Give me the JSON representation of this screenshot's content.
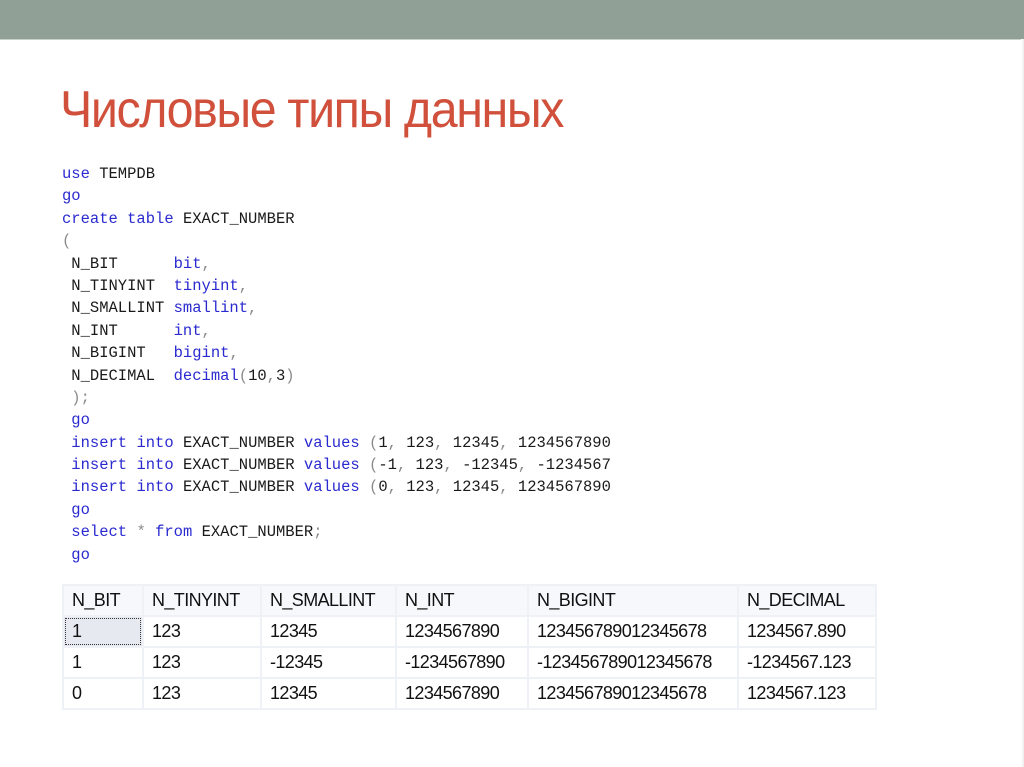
{
  "slide": {
    "title": "Числовые типы данных",
    "colors": {
      "top_bar": "#91a096",
      "title": "#d0503c",
      "keyword": "#2a2ad0"
    }
  },
  "code": {
    "lines": [
      [
        {
          "t": "kw",
          "v": "use"
        },
        {
          "t": "id",
          "v": " TEMPDB"
        }
      ],
      [
        {
          "t": "kw",
          "v": "go"
        }
      ],
      [
        {
          "t": "kw",
          "v": "create"
        },
        {
          "t": "id",
          "v": " "
        },
        {
          "t": "kw",
          "v": "table"
        },
        {
          "t": "id",
          "v": " EXACT_NUMBER"
        }
      ],
      [
        {
          "t": "pn",
          "v": "("
        }
      ],
      [
        {
          "t": "id",
          "v": " N_BIT      "
        },
        {
          "t": "kw",
          "v": "bit"
        },
        {
          "t": "pn",
          "v": ","
        }
      ],
      [
        {
          "t": "id",
          "v": " N_TINYINT  "
        },
        {
          "t": "kw",
          "v": "tinyint"
        },
        {
          "t": "pn",
          "v": ","
        }
      ],
      [
        {
          "t": "id",
          "v": " N_SMALLINT "
        },
        {
          "t": "kw",
          "v": "smallint"
        },
        {
          "t": "pn",
          "v": ","
        }
      ],
      [
        {
          "t": "id",
          "v": " N_INT      "
        },
        {
          "t": "kw",
          "v": "int"
        },
        {
          "t": "pn",
          "v": ","
        }
      ],
      [
        {
          "t": "id",
          "v": " N_BIGINT   "
        },
        {
          "t": "kw",
          "v": "bigint"
        },
        {
          "t": "pn",
          "v": ","
        }
      ],
      [
        {
          "t": "id",
          "v": " N_DECIMAL  "
        },
        {
          "t": "kw",
          "v": "decimal"
        },
        {
          "t": "pn",
          "v": "("
        },
        {
          "t": "num",
          "v": "10"
        },
        {
          "t": "pn",
          "v": ","
        },
        {
          "t": "num",
          "v": "3"
        },
        {
          "t": "pn",
          "v": ")"
        }
      ],
      [
        {
          "t": "pn",
          "v": " );"
        }
      ],
      [
        {
          "t": "kw",
          "v": " go"
        }
      ],
      [
        {
          "t": "kw",
          "v": " insert"
        },
        {
          "t": "id",
          "v": " "
        },
        {
          "t": "kw",
          "v": "into"
        },
        {
          "t": "id",
          "v": " EXACT_NUMBER "
        },
        {
          "t": "kw",
          "v": "values"
        },
        {
          "t": "id",
          "v": " "
        },
        {
          "t": "pn",
          "v": "("
        },
        {
          "t": "num",
          "v": "1"
        },
        {
          "t": "pn",
          "v": ", "
        },
        {
          "t": "num",
          "v": "123"
        },
        {
          "t": "pn",
          "v": ", "
        },
        {
          "t": "num",
          "v": "12345"
        },
        {
          "t": "pn",
          "v": ", "
        },
        {
          "t": "num",
          "v": "1234567890"
        }
      ],
      [
        {
          "t": "kw",
          "v": " insert"
        },
        {
          "t": "id",
          "v": " "
        },
        {
          "t": "kw",
          "v": "into"
        },
        {
          "t": "id",
          "v": " EXACT_NUMBER "
        },
        {
          "t": "kw",
          "v": "values"
        },
        {
          "t": "id",
          "v": " "
        },
        {
          "t": "pn",
          "v": "("
        },
        {
          "t": "num",
          "v": "-1"
        },
        {
          "t": "pn",
          "v": ", "
        },
        {
          "t": "num",
          "v": "123"
        },
        {
          "t": "pn",
          "v": ", "
        },
        {
          "t": "num",
          "v": "-12345"
        },
        {
          "t": "pn",
          "v": ", "
        },
        {
          "t": "num",
          "v": "-1234567"
        }
      ],
      [
        {
          "t": "kw",
          "v": " insert"
        },
        {
          "t": "id",
          "v": " "
        },
        {
          "t": "kw",
          "v": "into"
        },
        {
          "t": "id",
          "v": " EXACT_NUMBER "
        },
        {
          "t": "kw",
          "v": "values"
        },
        {
          "t": "id",
          "v": " "
        },
        {
          "t": "pn",
          "v": "("
        },
        {
          "t": "num",
          "v": "0"
        },
        {
          "t": "pn",
          "v": ", "
        },
        {
          "t": "num",
          "v": "123"
        },
        {
          "t": "pn",
          "v": ", "
        },
        {
          "t": "num",
          "v": "12345"
        },
        {
          "t": "pn",
          "v": ", "
        },
        {
          "t": "num",
          "v": "1234567890"
        }
      ],
      [
        {
          "t": "kw",
          "v": " go"
        }
      ],
      [
        {
          "t": "kw",
          "v": " select"
        },
        {
          "t": "id",
          "v": " "
        },
        {
          "t": "pn",
          "v": "*"
        },
        {
          "t": "id",
          "v": " "
        },
        {
          "t": "kw",
          "v": "from"
        },
        {
          "t": "id",
          "v": " EXACT_NUMBER"
        },
        {
          "t": "pn",
          "v": ";"
        }
      ],
      [
        {
          "t": "kw",
          "v": " go"
        }
      ]
    ]
  },
  "results": {
    "columns": [
      "N_BIT",
      "N_TINYINT",
      "N_SMALLINT",
      "N_INT",
      "N_BIGINT",
      "N_DECIMAL"
    ],
    "rows": [
      [
        "1",
        "123",
        "12345",
        "1234567890",
        "123456789012345678",
        "1234567.890"
      ],
      [
        "1",
        "123",
        "-12345",
        "-1234567890",
        "-123456789012345678",
        "-1234567.123"
      ],
      [
        "0",
        "123",
        "12345",
        "1234567890",
        "123456789012345678",
        "1234567.123"
      ]
    ],
    "selected_cell": {
      "row": 0,
      "col": 0
    }
  }
}
